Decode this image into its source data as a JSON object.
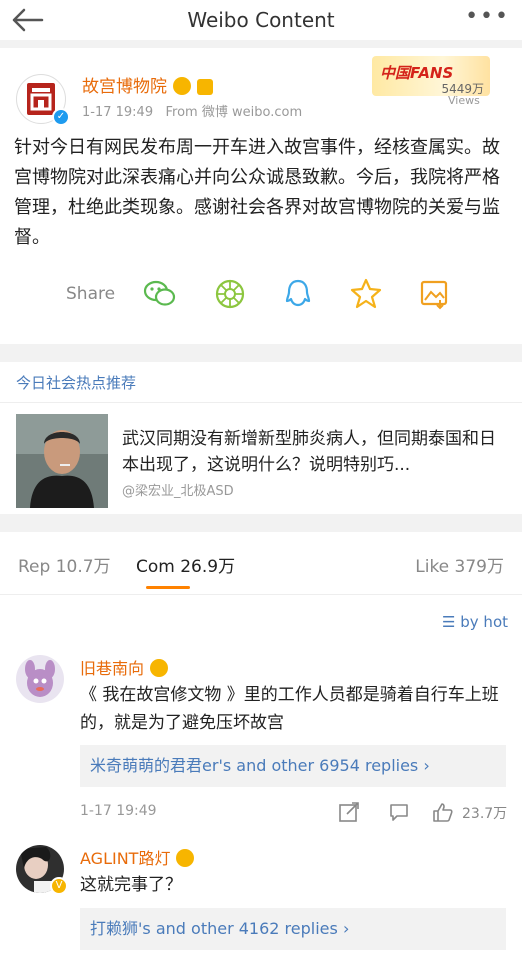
{
  "header": {
    "title": "Weibo Content"
  },
  "post": {
    "author": "故宫博物院",
    "time": "1-17 19:49",
    "source": "From 微博 weibo.com",
    "fans_logo": "中国FANS",
    "fans_count": "5449万",
    "views_label": "Views",
    "content": "针对今日有网民发布周一开车进入故宫事件，经核查属实。故宫博物院对此深表痛心并向公众诚恳致歉。今后，我院将严格管理，杜绝此类现象。感谢社会各界对故宫博物院的关爱与监督。",
    "share_label": "Share",
    "share_icons": [
      "wechat-icon",
      "moments-icon",
      "qq-icon",
      "qzone-star-icon",
      "save-image-icon"
    ]
  },
  "hot": {
    "title": "今日社会热点推荐",
    "text": "武汉同期没有新增新型肺炎病人，但同期泰国和日本出现了，这说明什么？说明特别巧...",
    "user": "@梁宏业_北极ASD"
  },
  "tabs": {
    "rep": "Rep 10.7万",
    "com": "Com 26.9万",
    "like": "Like 379万"
  },
  "sort_label": "by hot",
  "comments": [
    {
      "name": "旧巷南向",
      "text": "《 我在故宫修文物 》里的工作人员都是骑着自行车上班的，就是为了避免压坏故宫",
      "replies_user": "米奇萌萌的君君er",
      "replies_text": "'s and other 6954 replies",
      "time": "1-17 19:49",
      "likes": "23.7万"
    },
    {
      "name": "AGLINT路灯",
      "text": "这就完事了？",
      "replies_user": "打赖狮",
      "replies_text": "'s and other 4162 replies"
    }
  ],
  "colors": {
    "accent": "#ff8200",
    "author": "#e86b0a",
    "link": "#4a7bba",
    "verify": "#1e9bef"
  }
}
